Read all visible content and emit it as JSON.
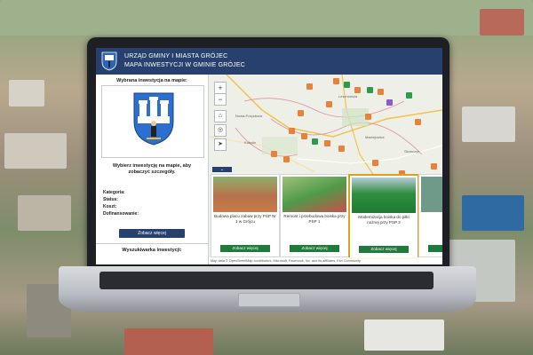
{
  "header": {
    "line1": "URZĄD GMINY I MIASTA GRÓJEC",
    "line2": "MAPA INWESTYCJI W GMINIE GRÓJEC"
  },
  "left_panel": {
    "selected_title": "Wybrana inwestycja na mapie:",
    "hint": "Wybierz inwestycję na mapie, aby zobaczyć szczegóły.",
    "fields": [
      "Kategoria:",
      "Status:",
      "Koszt:",
      "Dofinansowanie:"
    ],
    "more_button": "Zobacz więcej",
    "search_title": "Wyszukiwarka inwestycji:"
  },
  "map": {
    "zoom_in": "+",
    "zoom_out": "−",
    "labels": [
      "Nowa-Przęsłowa",
      "Lesznowola",
      "Maciejowice",
      "Słomczyn",
      "Kobylin"
    ],
    "collapse_icon": "⌄",
    "attribution": "Map data © OpenStreetMap contributors, Microsoft, Facebook, Inc. and its affiliates, Esri Community"
  },
  "cards": [
    {
      "title": "Budowa placu zabaw przy PSP Nr 1 w Grójcu",
      "button": "Zobacz więcej",
      "selected": false
    },
    {
      "title": "Remont i przebudowa boiska przy PSP 1",
      "button": "Zobacz więcej",
      "selected": false
    },
    {
      "title": "Modernizacja boiska do piłki nożnej przy PSP 2",
      "button": "Zobacz więcej",
      "selected": true
    },
    {
      "title": "B",
      "button": "Z",
      "selected": false
    }
  ],
  "colors": {
    "header_bg": "#27406d",
    "card_button": "#1f7a3c",
    "selected_border": "#d9a31a",
    "pin_orange": "#e8823a",
    "pin_green": "#2f9a4e"
  }
}
